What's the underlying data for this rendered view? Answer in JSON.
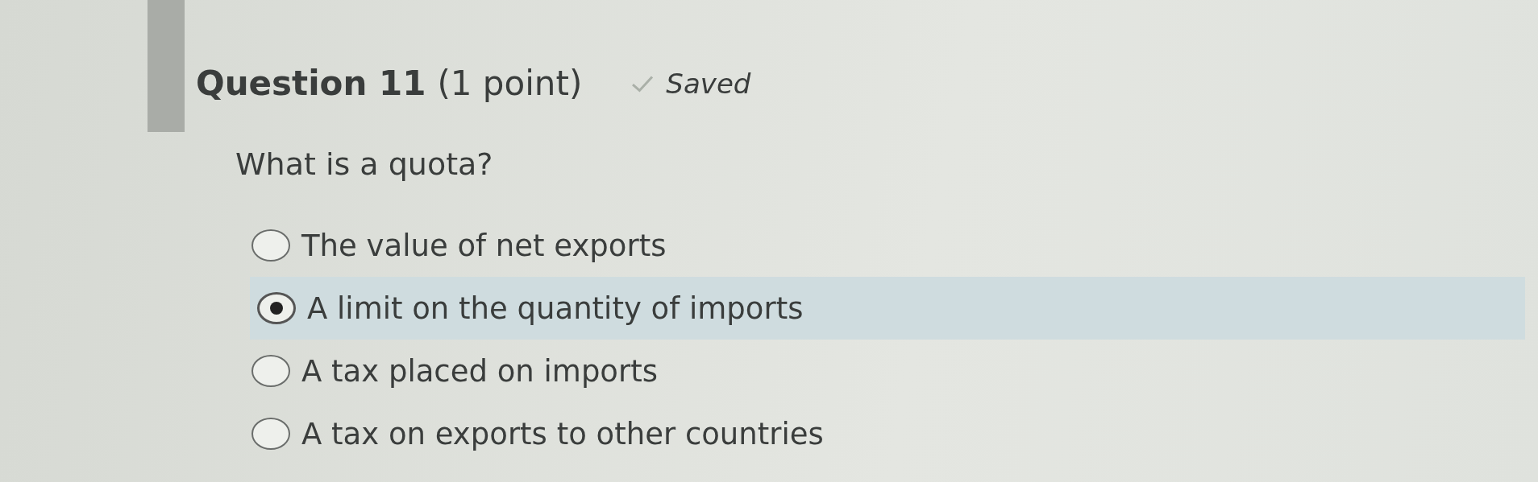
{
  "question": {
    "title": "Question 11",
    "points": "(1 point)",
    "status": "Saved",
    "saved": true,
    "prompt": "What is a quota?"
  },
  "options": [
    {
      "label": "The value of net exports",
      "selected": false
    },
    {
      "label": "A limit on the quantity of imports",
      "selected": true
    },
    {
      "label": "A tax placed on imports",
      "selected": false
    },
    {
      "label": "A tax on exports to other countries",
      "selected": false
    }
  ]
}
